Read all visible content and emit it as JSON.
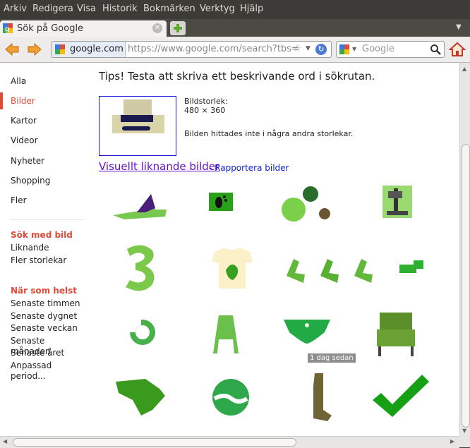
{
  "menu": {
    "items": [
      "Arkiv",
      "Redigera",
      "Visa",
      "Historik",
      "Bokmärken",
      "Verktyg",
      "Hjälp"
    ]
  },
  "tab": {
    "title": "Sök på Google"
  },
  "nav": {
    "site": "google.com",
    "url": "https://www.google.com/search?tbs=",
    "search_placeholder": "Google"
  },
  "sidebar": {
    "items": [
      "Alla",
      "Bilder",
      "Kartor",
      "Videor",
      "Nyheter",
      "Shopping",
      "Fler"
    ],
    "active_index": 1,
    "search_by_image": {
      "title": "Sök med bild",
      "links": [
        "Liknande",
        "Fler storlekar"
      ]
    },
    "time": {
      "title": "När som helst",
      "links": [
        "Senaste timmen",
        "Senaste dygnet",
        "Senaste veckan",
        "Senaste månaden",
        "Senaste året",
        "Anpassad period..."
      ]
    }
  },
  "main": {
    "tip": "Tips! Testa att skriva ett beskrivande ord i sökrutan.",
    "size_label": "Bildstorlek:",
    "size_value": "480 × 360",
    "not_found": "Bilden hittades inte i några andra storlekar.",
    "visually_similar": "Visuellt liknande bilder",
    "report": "- Rapportera bilder",
    "time_tag": "1 dag sedan"
  },
  "results": [
    "green-purple-shoe",
    "footprint-card",
    "green-blobs",
    "machine-photo",
    "number-three",
    "tshirt-character",
    "green-chairs",
    "green-pipe",
    "green-ring",
    "green-chair",
    "green-briefs",
    "green-armchair",
    "state-map",
    "s-logo",
    "green-sock",
    "checkmark"
  ],
  "colors": {
    "accent": "#dd4b39",
    "link": "#1122cc",
    "visited": "#6611cc",
    "green": "#4fbe3c"
  }
}
